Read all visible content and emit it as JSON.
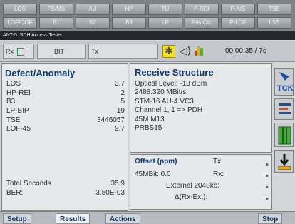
{
  "led_rows": [
    [
      "LOS",
      "FS/MS",
      "AU",
      "HP",
      "TU",
      "P-RDI",
      "P-AIS",
      "TSE"
    ],
    [
      "LOF/OOF",
      "B1",
      "B2",
      "B3",
      "LP",
      "PastOtc",
      "P-LOF",
      "LSS"
    ]
  ],
  "title_bar": "ANT-5: SDH Access Tester",
  "toolbar": {
    "rx_label": "Rx",
    "bit_label": "BIT",
    "tx_label": "Tx",
    "clock": "00:00:35 / 7c"
  },
  "defect_panel": {
    "title": "Defect/Anomaly",
    "rows": [
      {
        "label": "LOS",
        "value": "3.7"
      },
      {
        "label": "HP-REI",
        "value": "2"
      },
      {
        "label": "B3",
        "value": "5"
      },
      {
        "label": "LP-BIP",
        "value": "19"
      },
      {
        "label": "TSE",
        "value": "3446057"
      },
      {
        "label": "LOF-45",
        "value": "9.7"
      }
    ],
    "total_seconds_label": "Total Seconds",
    "total_seconds_value": "35.9",
    "ber_label": "BER:",
    "ber_value": "3.50E-03"
  },
  "receive_panel": {
    "title": "Receive Structure",
    "lines": [
      "Optical   Level: -13 dBm",
      "2488.320 MBit/s",
      "STM-16 AU-4 VC3",
      "Channel 1, 1  => PDH",
      "45M   M13",
      "PRBS15"
    ]
  },
  "offset_panel": {
    "title": "Offset (ppm)",
    "tx_label": "Tx:",
    "rate_label": "45MBit: 0.0",
    "rx_label": "Rx:",
    "external_label": "External 2048kb:",
    "delta_label": "Δ(Rx-Ext):"
  },
  "side_icons": [
    "tck-icon",
    "list-icon",
    "columns-icon",
    "download-icon"
  ],
  "tabs": {
    "setup": "Setup",
    "results": "Results",
    "actions": "Actions",
    "stop": "Stop"
  }
}
